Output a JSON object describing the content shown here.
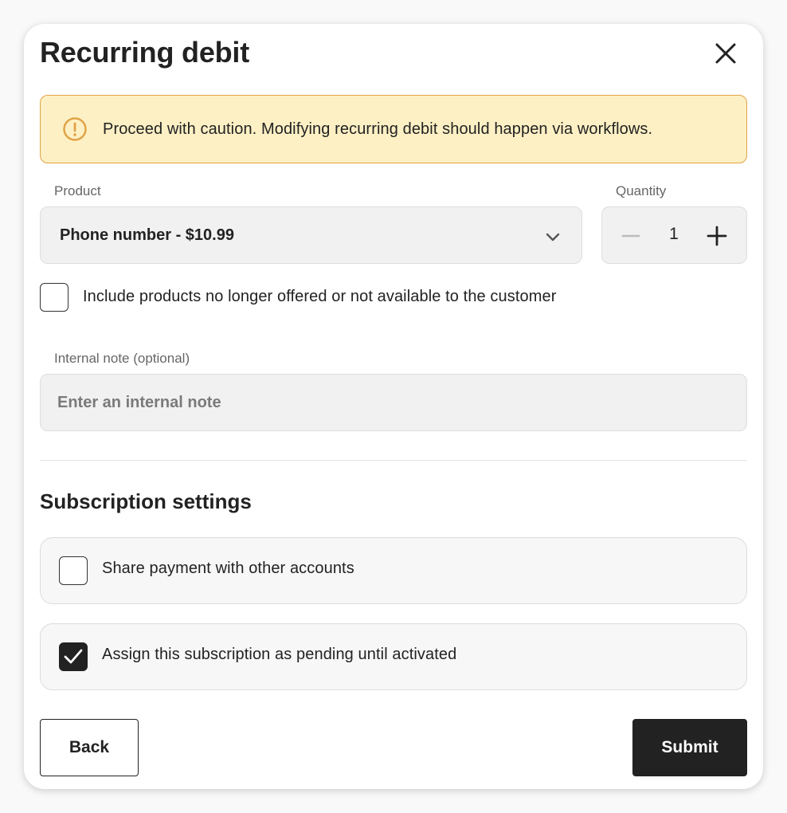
{
  "dialog": {
    "title": "Recurring debit"
  },
  "warning": {
    "text": "Proceed with caution. Modifying recurring debit should happen via workflows.",
    "color": "#e1a347",
    "background": "#fdf0c4"
  },
  "product": {
    "label": "Product",
    "selected": "Phone number - $10.99"
  },
  "quantity": {
    "label": "Quantity",
    "value": "1"
  },
  "include_unavailable": {
    "label": "Include products no longer offered or not available to the customer",
    "checked": false
  },
  "note": {
    "label": "Internal note (optional)",
    "placeholder": "Enter an internal note",
    "value": ""
  },
  "subscription_settings": {
    "title": "Subscription settings",
    "options": [
      {
        "label": "Share payment with other accounts",
        "checked": false
      },
      {
        "label": "Assign this subscription as pending until activated",
        "checked": true
      }
    ]
  },
  "footer": {
    "back_label": "Back",
    "submit_label": "Submit"
  },
  "icons": {
    "close": "close-icon",
    "warning": "warning-circle-icon",
    "chevron": "chevron-down-icon",
    "minus": "minus-icon",
    "plus": "plus-icon",
    "check": "checkmark-icon"
  }
}
